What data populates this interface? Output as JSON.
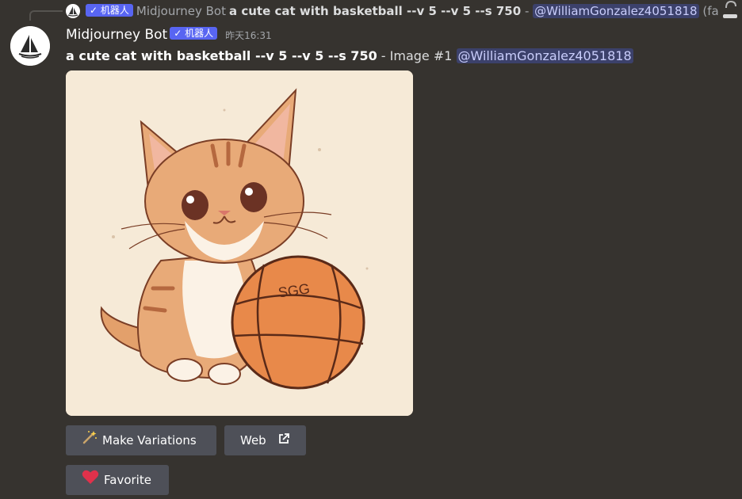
{
  "reply": {
    "badge": "✓ 机器人",
    "bot_name": "Midjourney Bot",
    "prompt": "a cute cat with basketball --v 5 --v 5 --s 750",
    "separator": "-",
    "mention": "@WilliamGonzalez4051818",
    "speed": "(fast)"
  },
  "message": {
    "username": "Midjourney Bot",
    "badge": "✓ 机器人",
    "timestamp": "昨天16:31",
    "prompt": "a cute cat with basketball --v 5 --v 5 --s 750",
    "suffix": " - Image #1 ",
    "mention": "@WilliamGonzalez4051818"
  },
  "image": {
    "ball_text": "SGG",
    "alt_subject": "cute cat with basketball illustration"
  },
  "buttons": {
    "variations": "Make Variations",
    "variations_icon": "magic-wand-icon",
    "web": "Web",
    "web_icon": "external-link-icon",
    "favorite": "Favorite",
    "favorite_icon": "heart-icon"
  },
  "colors": {
    "background": "#36332f",
    "badge": "#5865f2",
    "mention_bg": "#3c416b",
    "button": "#4e5058",
    "heart": "#e0314b"
  }
}
